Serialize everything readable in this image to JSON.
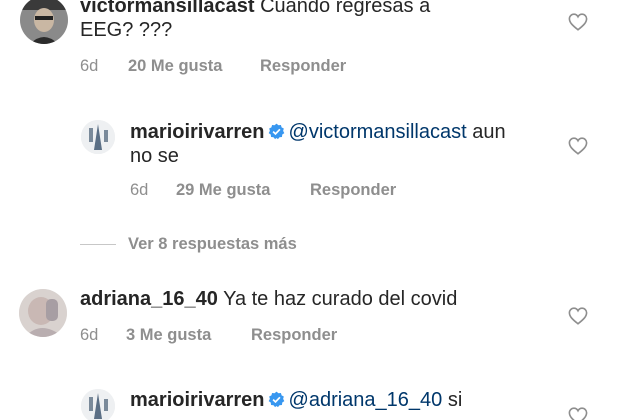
{
  "comments": [
    {
      "username": "victormansillacast",
      "text": "Cuando regresas a",
      "text_line2": "EEG? ???",
      "time": "6d",
      "likes": "20 Me gusta",
      "reply": "Responder"
    },
    {
      "username": "marioirivarren",
      "verified": true,
      "mention": "@victormansillacast",
      "text": "aun",
      "text_line2": "no se",
      "time": "6d",
      "likes": "29 Me gusta",
      "reply": "Responder"
    },
    {
      "username": "adriana_16_40",
      "text": "Ya te haz curado del covid",
      "time": "6d",
      "likes": "3 Me gusta",
      "reply": "Responder"
    },
    {
      "username": "marioirivarren",
      "verified": true,
      "mention": "@adriana_16_40",
      "text": "si"
    }
  ],
  "view_more": "Ver 8 respuestas más",
  "colors": {
    "text": "#262626",
    "meta": "#8e8e8e",
    "mention": "#00376b",
    "verified": "#3897f0"
  },
  "icons": {
    "like": "heart-outline-icon",
    "verified": "verified-badge-icon"
  }
}
